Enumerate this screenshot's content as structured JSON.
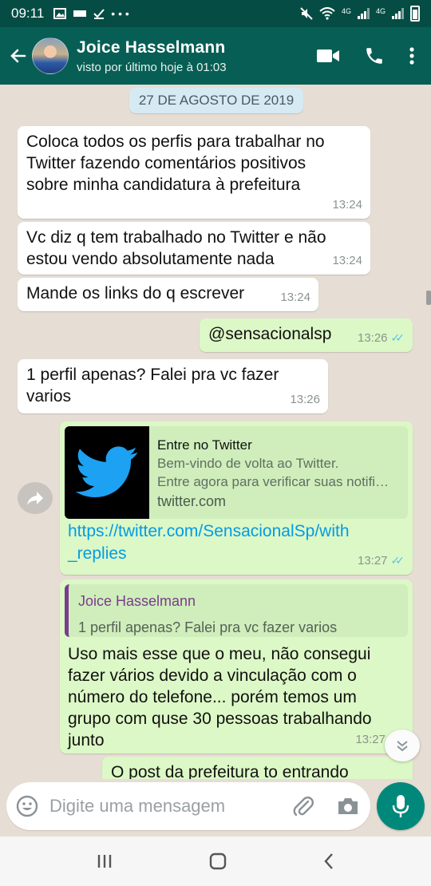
{
  "status_bar": {
    "time": "09:11",
    "left_icons": [
      "image-icon",
      "news-icon",
      "check-icon",
      "more-dots-icon"
    ],
    "right_icons": [
      "mute-icon",
      "wifi-icon",
      "signal-icon",
      "signal-icon",
      "battery-icon"
    ],
    "network_1": "4G",
    "network_2": "4G"
  },
  "header": {
    "contact_name": "Joice Hasselmann",
    "last_seen": "visto por último hoje à 01:03",
    "actions": [
      "video-call-icon",
      "voice-call-icon",
      "menu-icon"
    ]
  },
  "chat": {
    "date_chip": "27 DE AGOSTO DE 2019",
    "messages": [
      {
        "direction": "in",
        "text_lines": [
          "Coloca todos os perfis para trabalhar no",
          "Twitter fazendo comentários positivos",
          "sobre minha candidatura à prefeitura"
        ],
        "time": "13:24"
      },
      {
        "direction": "in",
        "text_lines": [
          "Vc diz q tem trabalhado no Twitter e não",
          "estou vendo absolutamente nada"
        ],
        "time": "13:24"
      },
      {
        "direction": "in",
        "text_lines": [
          "Mande os links do q escrever"
        ],
        "time": "13:24"
      },
      {
        "direction": "out",
        "text_lines": [
          "@sensacionalsp"
        ],
        "time": "13:26",
        "ticks": "✓✓"
      },
      {
        "direction": "in",
        "text_lines": [
          "1 perfil apenas? Falei pra vc fazer",
          "varios"
        ],
        "time": "13:26"
      },
      {
        "direction": "out",
        "link_preview": {
          "title": "Entre no Twitter",
          "description_1": "Bem-vindo de volta ao Twitter.",
          "description_2": "Entre agora para verificar suas notifi…",
          "domain": "twitter.com"
        },
        "link_lines": [
          "https://twitter.com/SensacionalSp/with",
          "_replies"
        ],
        "time": "13:27",
        "ticks": "✓✓"
      },
      {
        "direction": "out",
        "quote": {
          "author": "Joice Hasselmann",
          "text": "1 perfil apenas? Falei pra vc fazer varios"
        },
        "text_lines": [
          "Uso mais esse que o meu, não consegui",
          "fazer vários devido a vinculação com o",
          "número do telefone... porém temos um",
          "grupo com quse 30 pessoas trabalhando",
          "junto"
        ],
        "time": "13:27"
      },
      {
        "direction": "out",
        "text_lines": [
          "O post da prefeitura to entrando"
        ]
      }
    ]
  },
  "composer": {
    "placeholder": "Digite uma mensagem",
    "icons": [
      "emoji-icon",
      "attach-icon",
      "camera-icon",
      "mic-icon"
    ]
  },
  "colors": {
    "status_bar": "#054d44",
    "header": "#075e54",
    "incoming_bubble": "#ffffff",
    "outgoing_bubble": "#dcf8c6",
    "link": "#039be5",
    "quote_author": "#7a3c8e",
    "mic_button": "#00897b",
    "read_ticks": "#4fc3f7"
  }
}
